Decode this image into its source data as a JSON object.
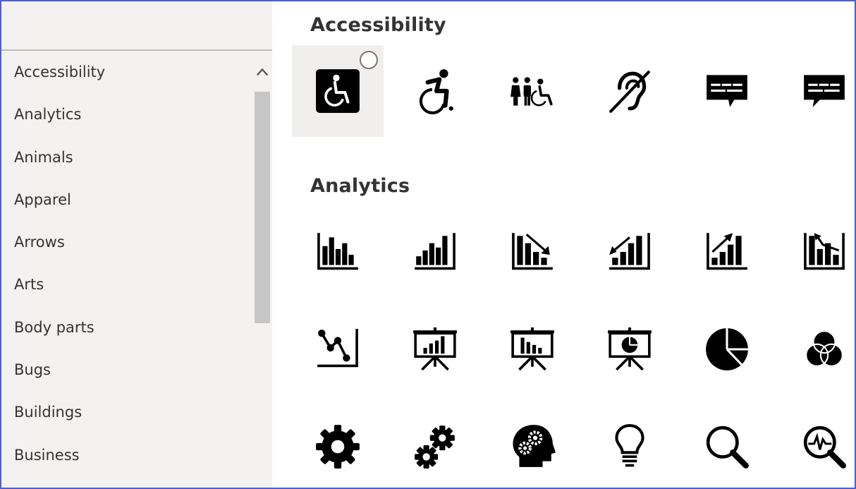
{
  "sidebar": {
    "categories": [
      "Accessibility",
      "Analytics",
      "Animals",
      "Apparel",
      "Arrows",
      "Arts",
      "Body parts",
      "Bugs",
      "Buildings",
      "Business"
    ]
  },
  "sections": {
    "accessibility": {
      "title": "Accessibility",
      "icons": [
        "wheelchair-sign-icon",
        "active-wheelchair-icon",
        "family-wheelchair-icon",
        "hearing-impaired-icon",
        "closed-caption-icon",
        "closed-caption-alt-icon"
      ]
    },
    "analytics": {
      "title": "Analytics",
      "icons": [
        "bar-chart-icon",
        "bar-chart-rising-icon",
        "bar-chart-down-arrow-icon",
        "bar-chart-up-arrow-left-icon",
        "bar-chart-up-arrow-icon",
        "bar-chart-up-down-arrow-icon",
        "line-chart-icon",
        "presentation-bar-chart-icon",
        "presentation-bar-chart-alt-icon",
        "presentation-pie-chart-icon",
        "pie-chart-icon",
        "venn-diagram-icon",
        "gear-icon",
        "gears-icon",
        "head-gears-icon",
        "lightbulb-icon",
        "magnifying-glass-icon",
        "magnifier-pulse-icon"
      ]
    }
  },
  "colors": {
    "frame_border": "#4a5fd8",
    "sidebar_bg": "#f3f2f1",
    "scroll_thumb": "#c6c6c6",
    "icon_fill": "#000000"
  }
}
